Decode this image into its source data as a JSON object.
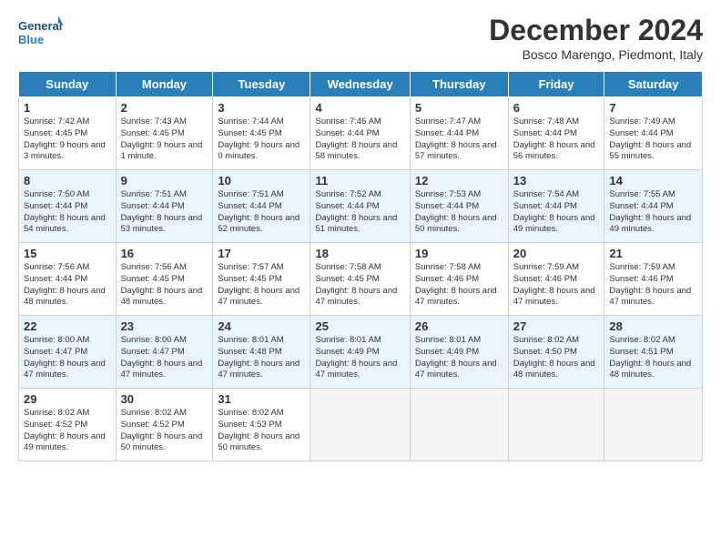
{
  "logo": {
    "line1": "General",
    "line2": "Blue"
  },
  "title": "December 2024",
  "subtitle": "Bosco Marengo, Piedmont, Italy",
  "headers": [
    "Sunday",
    "Monday",
    "Tuesday",
    "Wednesday",
    "Thursday",
    "Friday",
    "Saturday"
  ],
  "weeks": [
    [
      {
        "day": "1",
        "rise": "7:42 AM",
        "set": "4:45 PM",
        "daylight": "9 hours and 3 minutes."
      },
      {
        "day": "2",
        "rise": "7:43 AM",
        "set": "4:45 PM",
        "daylight": "9 hours and 1 minute."
      },
      {
        "day": "3",
        "rise": "7:44 AM",
        "set": "4:45 PM",
        "daylight": "9 hours and 0 minutes."
      },
      {
        "day": "4",
        "rise": "7:46 AM",
        "set": "4:44 PM",
        "daylight": "8 hours and 58 minutes."
      },
      {
        "day": "5",
        "rise": "7:47 AM",
        "set": "4:44 PM",
        "daylight": "8 hours and 57 minutes."
      },
      {
        "day": "6",
        "rise": "7:48 AM",
        "set": "4:44 PM",
        "daylight": "8 hours and 56 minutes."
      },
      {
        "day": "7",
        "rise": "7:49 AM",
        "set": "4:44 PM",
        "daylight": "8 hours and 55 minutes."
      }
    ],
    [
      {
        "day": "8",
        "rise": "7:50 AM",
        "set": "4:44 PM",
        "daylight": "8 hours and 54 minutes."
      },
      {
        "day": "9",
        "rise": "7:51 AM",
        "set": "4:44 PM",
        "daylight": "8 hours and 53 minutes."
      },
      {
        "day": "10",
        "rise": "7:51 AM",
        "set": "4:44 PM",
        "daylight": "8 hours and 52 minutes."
      },
      {
        "day": "11",
        "rise": "7:52 AM",
        "set": "4:44 PM",
        "daylight": "8 hours and 51 minutes."
      },
      {
        "day": "12",
        "rise": "7:53 AM",
        "set": "4:44 PM",
        "daylight": "8 hours and 50 minutes."
      },
      {
        "day": "13",
        "rise": "7:54 AM",
        "set": "4:44 PM",
        "daylight": "8 hours and 49 minutes."
      },
      {
        "day": "14",
        "rise": "7:55 AM",
        "set": "4:44 PM",
        "daylight": "8 hours and 49 minutes."
      }
    ],
    [
      {
        "day": "15",
        "rise": "7:56 AM",
        "set": "4:44 PM",
        "daylight": "8 hours and 48 minutes."
      },
      {
        "day": "16",
        "rise": "7:56 AM",
        "set": "4:45 PM",
        "daylight": "8 hours and 48 minutes."
      },
      {
        "day": "17",
        "rise": "7:57 AM",
        "set": "4:45 PM",
        "daylight": "8 hours and 47 minutes."
      },
      {
        "day": "18",
        "rise": "7:58 AM",
        "set": "4:45 PM",
        "daylight": "8 hours and 47 minutes."
      },
      {
        "day": "19",
        "rise": "7:58 AM",
        "set": "4:46 PM",
        "daylight": "8 hours and 47 minutes."
      },
      {
        "day": "20",
        "rise": "7:59 AM",
        "set": "4:46 PM",
        "daylight": "8 hours and 47 minutes."
      },
      {
        "day": "21",
        "rise": "7:59 AM",
        "set": "4:46 PM",
        "daylight": "8 hours and 47 minutes."
      }
    ],
    [
      {
        "day": "22",
        "rise": "8:00 AM",
        "set": "4:47 PM",
        "daylight": "8 hours and 47 minutes."
      },
      {
        "day": "23",
        "rise": "8:00 AM",
        "set": "4:47 PM",
        "daylight": "8 hours and 47 minutes."
      },
      {
        "day": "24",
        "rise": "8:01 AM",
        "set": "4:48 PM",
        "daylight": "8 hours and 47 minutes."
      },
      {
        "day": "25",
        "rise": "8:01 AM",
        "set": "4:49 PM",
        "daylight": "8 hours and 47 minutes."
      },
      {
        "day": "26",
        "rise": "8:01 AM",
        "set": "4:49 PM",
        "daylight": "8 hours and 47 minutes."
      },
      {
        "day": "27",
        "rise": "8:02 AM",
        "set": "4:50 PM",
        "daylight": "8 hours and 48 minutes."
      },
      {
        "day": "28",
        "rise": "8:02 AM",
        "set": "4:51 PM",
        "daylight": "8 hours and 48 minutes."
      }
    ],
    [
      {
        "day": "29",
        "rise": "8:02 AM",
        "set": "4:52 PM",
        "daylight": "8 hours and 49 minutes."
      },
      {
        "day": "30",
        "rise": "8:02 AM",
        "set": "4:52 PM",
        "daylight": "8 hours and 50 minutes."
      },
      {
        "day": "31",
        "rise": "8:02 AM",
        "set": "4:53 PM",
        "daylight": "8 hours and 50 minutes."
      },
      null,
      null,
      null,
      null
    ]
  ]
}
